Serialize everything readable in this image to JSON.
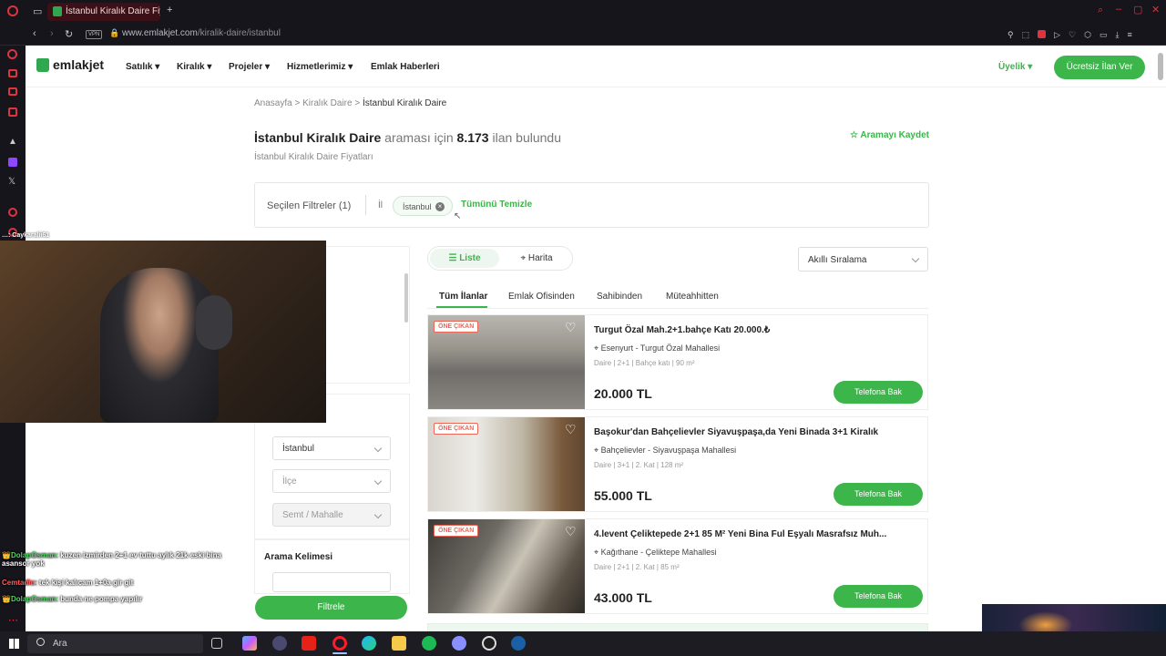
{
  "browser": {
    "tab_title": "İstanbul Kiralık Daire Fiyatl",
    "url_host": "www.emlakjet.com",
    "url_path": "/kiralik-daire/istanbul",
    "vpn_label": "VPN"
  },
  "header": {
    "logo": "emlakjet",
    "nav": [
      "Satılık",
      "Kiralık",
      "Projeler",
      "Hizmetlerimiz",
      "Emlak Haberleri"
    ],
    "membership": "Üyelik",
    "cta": "Ücretsiz İlan Ver"
  },
  "breadcrumb": [
    "Anasayfa",
    "Kiralık Daire",
    "İstanbul Kiralık Daire"
  ],
  "heading": {
    "query": "İstanbul Kiralık Daire",
    "middle": "araması için",
    "count": "8.173",
    "suffix": "ilan bulundu",
    "subtitle": "İstanbul Kiralık Daire Fiyatları",
    "save_search": "Aramayı Kaydet"
  },
  "filters": {
    "label": "Seçilen Filtreler (1)",
    "field": "İl",
    "chip": "İstanbul",
    "clear": "Tümünü Temizle"
  },
  "sidebar_filters": {
    "city": "İstanbul",
    "district": "İlçe",
    "neighborhood": "Semt / Mahalle",
    "keyword_title": "Arama Kelimesi",
    "apply": "Filtrele"
  },
  "view_toggle": {
    "list": "Liste",
    "map": "Harita"
  },
  "sort": "Akıllı Sıralama",
  "listing_tabs": [
    "Tüm İlanlar",
    "Emlak Ofisinden",
    "Sahibinden",
    "Müteahhitten"
  ],
  "listings": [
    {
      "badge": "ÖNE ÇIKAN",
      "title": "Turgut Özal Mah.2+1.bahçe Katı 20.000.₺",
      "location": "Esenyurt - Turgut Özal Mahallesi",
      "meta": "Daire | 2+1 | Bahçe katı | 90 m²",
      "price": "20.000 TL",
      "action": "Telefona Bak"
    },
    {
      "badge": "ÖNE ÇIKAN",
      "title": "Başokur'dan Bahçelievler Siyavuşpaşa,da Yeni Binada 3+1 Kiralık",
      "location": "Bahçelievler - Siyavuşpaşa Mahallesi",
      "meta": "Daire | 3+1 | 2. Kat | 128 m²",
      "price": "55.000 TL",
      "action": "Telefona Bak"
    },
    {
      "badge": "ÖNE ÇIKAN",
      "title": "4.levent Çeliktepede 2+1 85 M² Yeni Bina Ful Eşyalı Masrafsız Muh...",
      "location": "Kağıthane - Çeliktepe Mahallesi",
      "meta": "Daire | 2+1 | 2. Kat | 85 m²",
      "price": "43.000 TL",
      "action": "Telefona Bak"
    }
  ],
  "stream_chat": {
    "top_user": "Caykaralii61",
    "lines": [
      {
        "user": "DolapOsman:",
        "text": "kuzen izmirden 2+1 ev tuttu aylık 21k eski bina asansor yok"
      },
      {
        "user": "Cemtadic:",
        "text": "tek kişi kalıcam 1+0a gir git"
      },
      {
        "user": "DolapOsman:",
        "text": "bunda ne pompa yapılır"
      }
    ]
  },
  "taskbar": {
    "search": "Ara"
  },
  "colors": {
    "brand_green": "#3cb54a",
    "badge_red": "#ee6655",
    "chrome_dark": "#16151c"
  }
}
